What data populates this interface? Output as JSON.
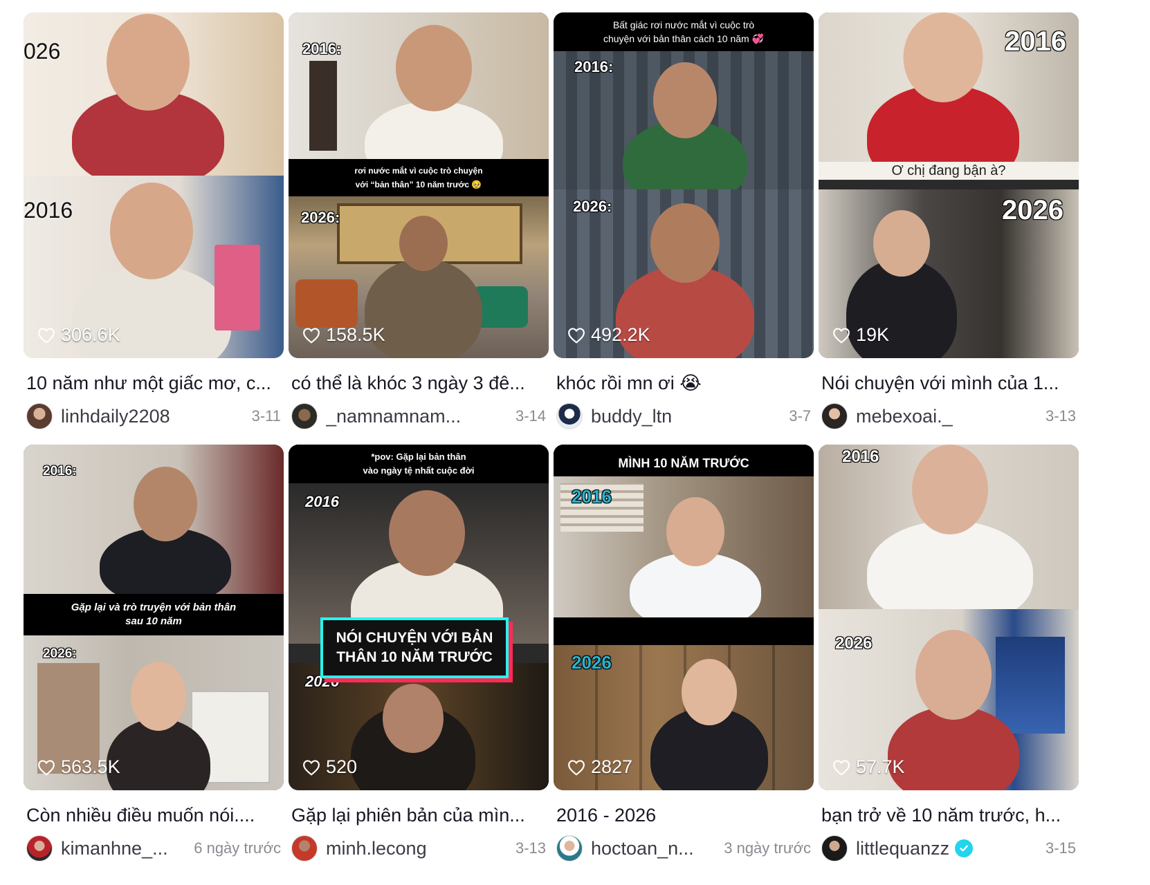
{
  "videos": [
    {
      "overlay": {
        "top_year": "026",
        "bottom_year": "2016"
      },
      "likes": "306.6K",
      "caption": "10 năm như một giấc mơ, c...",
      "author": "linhdaily2208",
      "date": "3-11",
      "verified": false
    },
    {
      "overlay": {
        "top_year": "2016:",
        "bottom_year": "2026:",
        "band": "rơi nước mắt vì cuộc trò chuyện\nvới “bản thân” 10 năm trước 🥹"
      },
      "likes": "158.5K",
      "caption": "có thể là khóc 3 ngày 3 đê...",
      "author": "_namnamnam...",
      "date": "3-14",
      "verified": false
    },
    {
      "overlay": {
        "top_year": "2016:",
        "bottom_year": "2026:",
        "band": "Bất giác rơi nước mắt vì cuộc trò\nchuyện với bản thân cách 10 năm 💞"
      },
      "likes": "492.2K",
      "caption": "khóc rồi mn ơi 😭",
      "author": "buddy_ltn",
      "date": "3-7",
      "verified": false
    },
    {
      "overlay": {
        "top_year": "2016",
        "bottom_year": "2026",
        "subtitle": "Ơ chị đang bận à?"
      },
      "likes": "19K",
      "caption": "Nói chuyện với mình của 1...",
      "author": "mebexoai._",
      "date": "3-13",
      "verified": false
    },
    {
      "overlay": {
        "top_year": "2016:",
        "bottom_year": "2026:",
        "band": "Gặp lại và trò truyện với bản thân\nsau 10 năm"
      },
      "likes": "563.5K",
      "caption": "Còn nhiều điều muốn nói....",
      "author": "kimanhne_...",
      "date": "6 ngày trước",
      "verified": false
    },
    {
      "overlay": {
        "top_year": "2016",
        "bottom_year": "2026",
        "band": "*pov: Gặp lại bản thân\nvào ngày tệ nhất cuộc đời",
        "box": "NÓI CHUYỆN VỚI BẢN\nTHÂN 10 NĂM TRƯỚC"
      },
      "likes": "520",
      "caption": "Gặp lại phiên bản của mìn...",
      "author": "minh.lecong",
      "date": "3-13",
      "verified": false
    },
    {
      "overlay": {
        "top_year": "2016",
        "bottom_year": "2026",
        "band": "MÌNH 10 NĂM TRƯỚC"
      },
      "likes": "2827",
      "caption": "2016 - 2026",
      "author": "hoctoan_n...",
      "date": "3 ngày trước",
      "verified": false
    },
    {
      "overlay": {
        "top_year": "2016",
        "bottom_year": "2026"
      },
      "likes": "57.7K",
      "caption": "bạn trở về 10 năm trước, h...",
      "author": "littlequanzz",
      "date": "3-15",
      "verified": true
    }
  ],
  "icons": {
    "likes": "heart-outline-icon",
    "verified": "check-badge-icon"
  },
  "colors": {
    "verified": "#20d5ec",
    "text": "#161823",
    "muted": "#8a8b91"
  }
}
